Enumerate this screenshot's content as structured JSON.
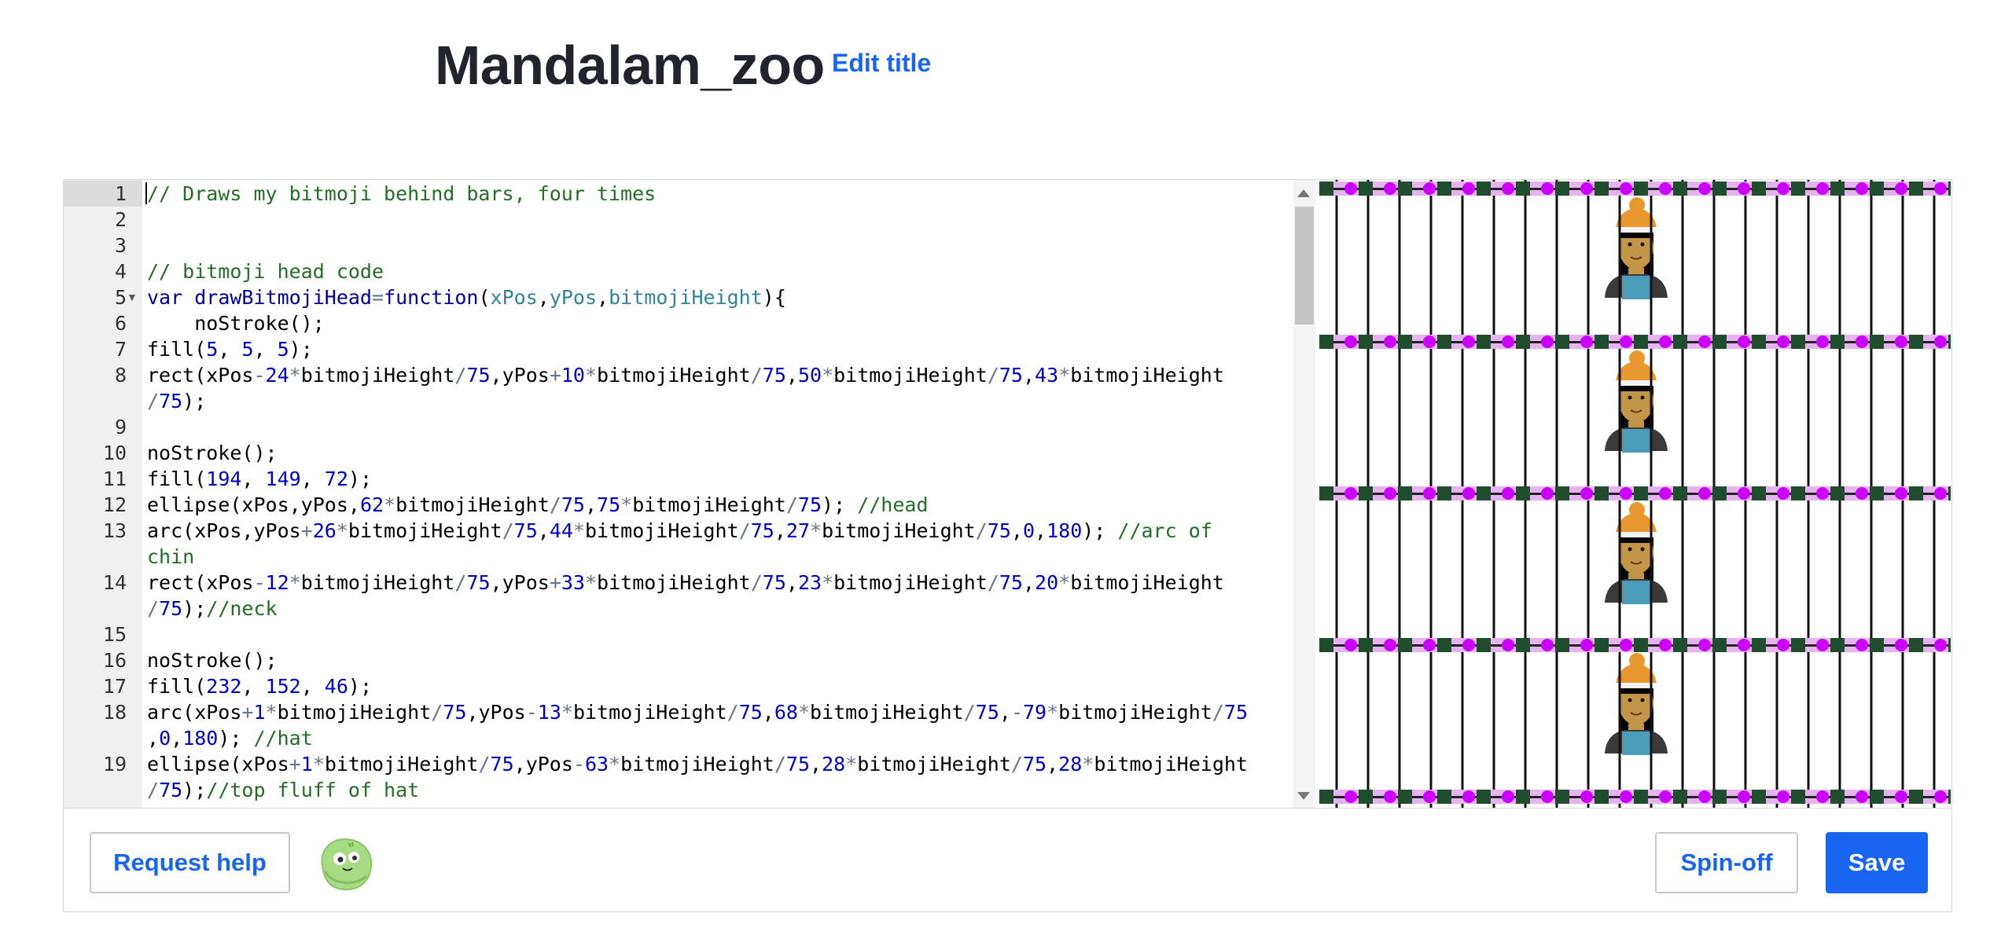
{
  "header": {
    "title": "Mandalam_zoo",
    "edit_title_label": "Edit title"
  },
  "editor": {
    "line_numbers": [
      "1",
      "2",
      "3",
      "4",
      "5",
      "6",
      "7",
      "8",
      "",
      "9",
      "10",
      "11",
      "12",
      "13",
      "",
      "14",
      "",
      "15",
      "16",
      "17",
      "18",
      "",
      "19",
      ""
    ],
    "code_lines": [
      [
        [
          "cm",
          "// Draws my bitmoji behind bars, four times"
        ]
      ],
      [],
      [],
      [
        [
          "cm",
          "// bitmoji head code"
        ]
      ],
      [
        [
          "kw",
          "var "
        ],
        [
          "fn",
          "drawBitmojiHead"
        ],
        [
          "op",
          "="
        ],
        [
          "kw",
          "function"
        ],
        [
          "",
          "("
        ],
        [
          "pa",
          "xPos"
        ],
        [
          "",
          ","
        ],
        [
          "pa",
          "yPos"
        ],
        [
          "",
          ","
        ],
        [
          "pa",
          "bitmojiHeight"
        ],
        [
          "",
          "){"
        ]
      ],
      [
        [
          "",
          "    noStroke();"
        ]
      ],
      [
        [
          "",
          "fill("
        ],
        [
          "num",
          "5"
        ],
        [
          "",
          ", "
        ],
        [
          "num",
          "5"
        ],
        [
          "",
          ", "
        ],
        [
          "num",
          "5"
        ],
        [
          "",
          ");"
        ]
      ],
      [
        [
          "",
          "rect(xPos"
        ],
        [
          "op",
          "-"
        ],
        [
          "num",
          "24"
        ],
        [
          "op",
          "*"
        ],
        [
          "",
          "bitmojiHeight"
        ],
        [
          "op",
          "/"
        ],
        [
          "num",
          "75"
        ],
        [
          "",
          ",yPos"
        ],
        [
          "op",
          "+"
        ],
        [
          "num",
          "10"
        ],
        [
          "op",
          "*"
        ],
        [
          "",
          "bitmojiHeight"
        ],
        [
          "op",
          "/"
        ],
        [
          "num",
          "75"
        ],
        [
          "",
          ","
        ],
        [
          "num",
          "50"
        ],
        [
          "op",
          "*"
        ],
        [
          "",
          "bitmojiHeight"
        ],
        [
          "op",
          "/"
        ],
        [
          "num",
          "75"
        ],
        [
          "",
          ","
        ],
        [
          "num",
          "43"
        ],
        [
          "op",
          "*"
        ],
        [
          "",
          "bitmojiHeight"
        ]
      ],
      [
        [
          "op",
          "/"
        ],
        [
          "num",
          "75"
        ],
        [
          "",
          ");"
        ]
      ],
      [],
      [
        [
          "",
          "noStroke();"
        ]
      ],
      [
        [
          "",
          "fill("
        ],
        [
          "num",
          "194"
        ],
        [
          "",
          ", "
        ],
        [
          "num",
          "149"
        ],
        [
          "",
          ", "
        ],
        [
          "num",
          "72"
        ],
        [
          "",
          ");"
        ]
      ],
      [
        [
          "",
          "ellipse(xPos,yPos,"
        ],
        [
          "num",
          "62"
        ],
        [
          "op",
          "*"
        ],
        [
          "",
          "bitmojiHeight"
        ],
        [
          "op",
          "/"
        ],
        [
          "num",
          "75"
        ],
        [
          "",
          ","
        ],
        [
          "num",
          "75"
        ],
        [
          "op",
          "*"
        ],
        [
          "",
          "bitmojiHeight"
        ],
        [
          "op",
          "/"
        ],
        [
          "num",
          "75"
        ],
        [
          "",
          "); "
        ],
        [
          "cm",
          "//head"
        ]
      ],
      [
        [
          "",
          "arc(xPos,yPos"
        ],
        [
          "op",
          "+"
        ],
        [
          "num",
          "26"
        ],
        [
          "op",
          "*"
        ],
        [
          "",
          "bitmojiHeight"
        ],
        [
          "op",
          "/"
        ],
        [
          "num",
          "75"
        ],
        [
          "",
          ","
        ],
        [
          "num",
          "44"
        ],
        [
          "op",
          "*"
        ],
        [
          "",
          "bitmojiHeight"
        ],
        [
          "op",
          "/"
        ],
        [
          "num",
          "75"
        ],
        [
          "",
          ","
        ],
        [
          "num",
          "27"
        ],
        [
          "op",
          "*"
        ],
        [
          "",
          "bitmojiHeight"
        ],
        [
          "op",
          "/"
        ],
        [
          "num",
          "75"
        ],
        [
          "",
          ","
        ],
        [
          "num",
          "0"
        ],
        [
          "",
          ","
        ],
        [
          "num",
          "180"
        ],
        [
          "",
          "); "
        ],
        [
          "cm",
          "//arc of"
        ]
      ],
      [
        [
          "cm",
          "chin"
        ]
      ],
      [
        [
          "",
          "rect(xPos"
        ],
        [
          "op",
          "-"
        ],
        [
          "num",
          "12"
        ],
        [
          "op",
          "*"
        ],
        [
          "",
          "bitmojiHeight"
        ],
        [
          "op",
          "/"
        ],
        [
          "num",
          "75"
        ],
        [
          "",
          ",yPos"
        ],
        [
          "op",
          "+"
        ],
        [
          "num",
          "33"
        ],
        [
          "op",
          "*"
        ],
        [
          "",
          "bitmojiHeight"
        ],
        [
          "op",
          "/"
        ],
        [
          "num",
          "75"
        ],
        [
          "",
          ","
        ],
        [
          "num",
          "23"
        ],
        [
          "op",
          "*"
        ],
        [
          "",
          "bitmojiHeight"
        ],
        [
          "op",
          "/"
        ],
        [
          "num",
          "75"
        ],
        [
          "",
          ","
        ],
        [
          "num",
          "20"
        ],
        [
          "op",
          "*"
        ],
        [
          "",
          "bitmojiHeight"
        ]
      ],
      [
        [
          "op",
          "/"
        ],
        [
          "num",
          "75"
        ],
        [
          "",
          ");"
        ],
        [
          "cm",
          "//neck"
        ]
      ],
      [],
      [
        [
          "",
          "noStroke();"
        ]
      ],
      [
        [
          "",
          "fill("
        ],
        [
          "num",
          "232"
        ],
        [
          "",
          ", "
        ],
        [
          "num",
          "152"
        ],
        [
          "",
          ", "
        ],
        [
          "num",
          "46"
        ],
        [
          "",
          ");"
        ]
      ],
      [
        [
          "",
          "arc(xPos"
        ],
        [
          "op",
          "+"
        ],
        [
          "num",
          "1"
        ],
        [
          "op",
          "*"
        ],
        [
          "",
          "bitmojiHeight"
        ],
        [
          "op",
          "/"
        ],
        [
          "num",
          "75"
        ],
        [
          "",
          ",yPos"
        ],
        [
          "op",
          "-"
        ],
        [
          "num",
          "13"
        ],
        [
          "op",
          "*"
        ],
        [
          "",
          "bitmojiHeight"
        ],
        [
          "op",
          "/"
        ],
        [
          "num",
          "75"
        ],
        [
          "",
          ","
        ],
        [
          "num",
          "68"
        ],
        [
          "op",
          "*"
        ],
        [
          "",
          "bitmojiHeight"
        ],
        [
          "op",
          "/"
        ],
        [
          "num",
          "75"
        ],
        [
          "",
          ","
        ],
        [
          "op",
          "-"
        ],
        [
          "num",
          "79"
        ],
        [
          "op",
          "*"
        ],
        [
          "",
          "bitmojiHeight"
        ],
        [
          "op",
          "/"
        ],
        [
          "num",
          "75"
        ]
      ],
      [
        [
          "",
          ","
        ],
        [
          "num",
          "0"
        ],
        [
          "",
          ","
        ],
        [
          "num",
          "180"
        ],
        [
          "",
          "); "
        ],
        [
          "cm",
          "//hat"
        ]
      ],
      [
        [
          "",
          "ellipse(xPos"
        ],
        [
          "op",
          "+"
        ],
        [
          "num",
          "1"
        ],
        [
          "op",
          "*"
        ],
        [
          "",
          "bitmojiHeight"
        ],
        [
          "op",
          "/"
        ],
        [
          "num",
          "75"
        ],
        [
          "",
          ",yPos"
        ],
        [
          "op",
          "-"
        ],
        [
          "num",
          "63"
        ],
        [
          "op",
          "*"
        ],
        [
          "",
          "bitmojiHeight"
        ],
        [
          "op",
          "/"
        ],
        [
          "num",
          "75"
        ],
        [
          "",
          ","
        ],
        [
          "num",
          "28"
        ],
        [
          "op",
          "*"
        ],
        [
          "",
          "bitmojiHeight"
        ],
        [
          "op",
          "/"
        ],
        [
          "num",
          "75"
        ],
        [
          "",
          ","
        ],
        [
          "num",
          "28"
        ],
        [
          "op",
          "*"
        ],
        [
          "",
          "bitmojiHeight"
        ]
      ],
      [
        [
          "op",
          "/"
        ],
        [
          "num",
          "75"
        ],
        [
          "",
          ");"
        ],
        [
          "cm",
          "//top fluff of hat"
        ]
      ]
    ]
  },
  "footer": {
    "request_help_label": "Request help",
    "spin_off_label": "Spin-off",
    "save_label": "Save"
  },
  "colors": {
    "accent": "#1865f2",
    "bar_stripe": "#e6b3f0",
    "dot": "#cc00ff",
    "square": "#1f4d2e",
    "hat": "#e8982e",
    "skin": "#c29548",
    "shirt": "#4a9cb8"
  },
  "icons": {
    "avatar": "green-blob-avatar-icon"
  }
}
